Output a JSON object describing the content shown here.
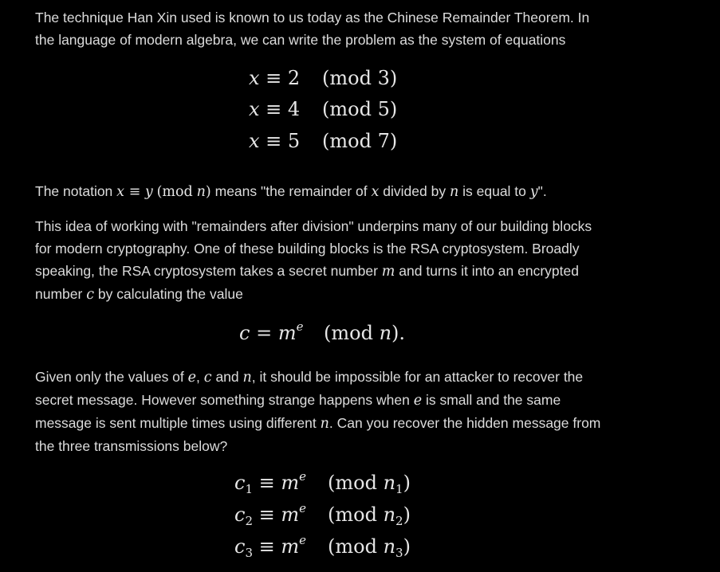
{
  "paragraphs": {
    "intro": "The technique Han Xin used is known to us today as the Chinese Remainder Theorem. In the language of modern algebra, we can write the problem as the system of equations",
    "notation_prefix": "The notation",
    "notation_math": "x ≡ y",
    "notation_mod": "(mod",
    "notation_n": "n",
    "notation_close": ")",
    "notation_mid": "means \"the remainder of",
    "notation_x": "x",
    "notation_divided": "divided by",
    "notation_n2": "n",
    "notation_equal": "is equal to",
    "notation_y": "y",
    "notation_end": "\".",
    "rsa_1": "This idea of working with \"remainders after division\" underpins many of our building blocks for modern cryptography. One of these building blocks is the RSA cryptosystem. Broadly speaking, the RSA cryptosystem takes a secret number",
    "rsa_m": "m",
    "rsa_2": "and turns it into an encrypted number",
    "rsa_c": "c",
    "rsa_3": "by calculating the value",
    "given_1": "Given only the values of",
    "given_e": "e",
    "given_c": "c",
    "given_and": "and",
    "given_n": "n",
    "given_2": ", it should be impossible for an attacker to recover the secret message. However something strange happens when",
    "given_e2": "e",
    "given_3": "is small and the same message is sent multiple times using different",
    "given_n2": "n",
    "given_4": ". Can you recover the hidden message from the three transmissions below?"
  },
  "crt_system": [
    {
      "lhs_var": "x",
      "lhs_rest": " ≡ 2",
      "mod": "(mod 3)"
    },
    {
      "lhs_var": "x",
      "lhs_rest": " ≡ 4",
      "mod": "(mod 5)"
    },
    {
      "lhs_var": "x",
      "lhs_rest": " ≡ 5",
      "mod": "(mod 7)"
    }
  ],
  "rsa_equation": {
    "c": "c",
    "eq": " = ",
    "m": "m",
    "e": "e",
    "mod_open": "(mod ",
    "n": "n",
    "mod_close": ")."
  },
  "transmissions": [
    {
      "c": "c",
      "sub": "1",
      "rel": " ≡ ",
      "m": "m",
      "e": "e",
      "mod_open": "(mod ",
      "n": "n",
      "nsub": "1",
      "close": ")"
    },
    {
      "c": "c",
      "sub": "2",
      "rel": " ≡ ",
      "m": "m",
      "e": "e",
      "mod_open": "(mod ",
      "n": "n",
      "nsub": "2",
      "close": ")"
    },
    {
      "c": "c",
      "sub": "3",
      "rel": " ≡ ",
      "m": "m",
      "e": "e",
      "mod_open": "(mod ",
      "n": "n",
      "nsub": "3",
      "close": ")"
    }
  ]
}
